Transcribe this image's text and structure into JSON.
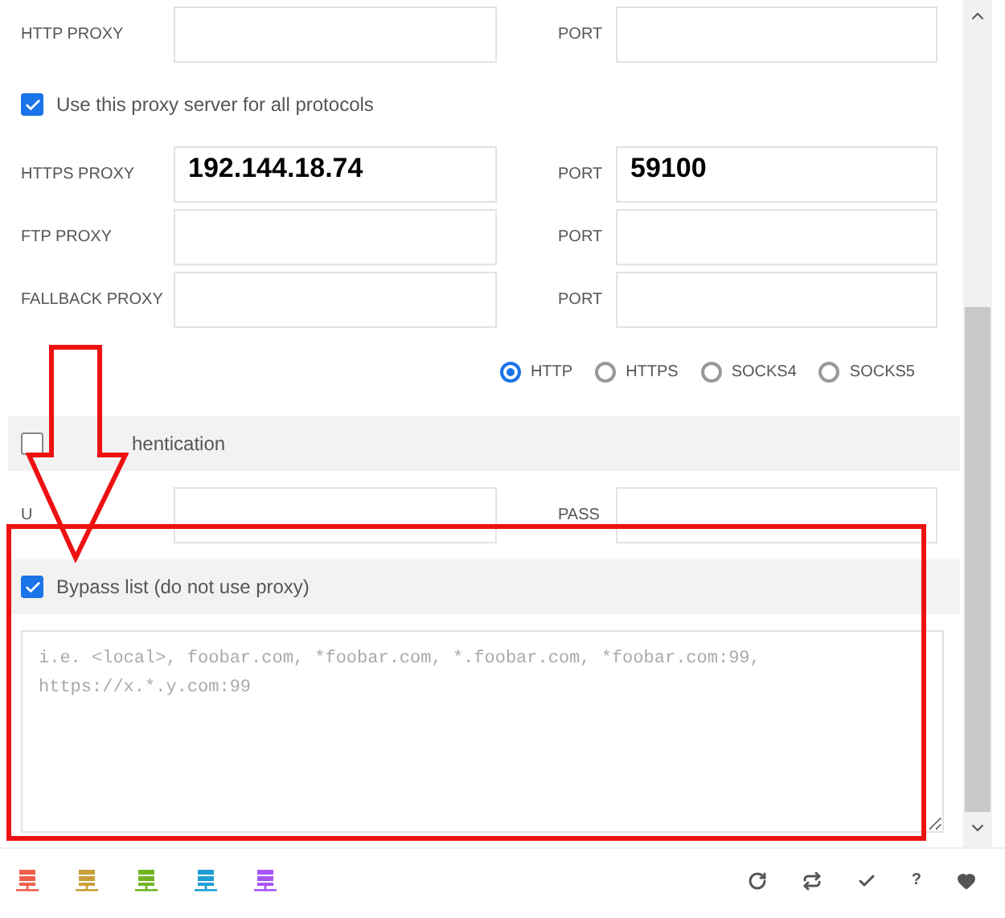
{
  "proxies": [
    {
      "label": "HTTP PROXY",
      "port_label": "PORT"
    },
    {
      "kind": "checkbox",
      "label": "Use this proxy server for all protocols",
      "checked": true
    },
    {
      "label": "HTTPS PROXY",
      "value": "192.144.18.74",
      "port_label": "PORT",
      "port": "59100"
    },
    {
      "label": "FTP PROXY",
      "port_label": "PORT"
    },
    {
      "label": "FALLBACK PROXY",
      "port_label": "PORT"
    }
  ],
  "protocols": [
    {
      "label": "HTTP",
      "selected": true
    },
    {
      "label": "HTTPS",
      "selected": false
    },
    {
      "label": "SOCKS4",
      "selected": false
    },
    {
      "label": "SOCKS5",
      "selected": false
    }
  ],
  "authentication": {
    "label": "hentication",
    "checked": false,
    "user_label": "U",
    "pass_label": "PASS"
  },
  "bypass": {
    "label": "Bypass list",
    "note": "(do not use proxy)",
    "checked": true,
    "placeholder": "i.e. <local>, foobar.com, *foobar.com, *.foobar.com, *foobar.com:99, https://x.*.y.com:99"
  },
  "toolbar": {
    "servers": [
      {
        "color": "#f0604c"
      },
      {
        "color": "#c9a038"
      },
      {
        "color": "#6fb51f"
      },
      {
        "color": "#1d9fd6"
      },
      {
        "color": "#a855f7"
      }
    ],
    "help": "?"
  }
}
